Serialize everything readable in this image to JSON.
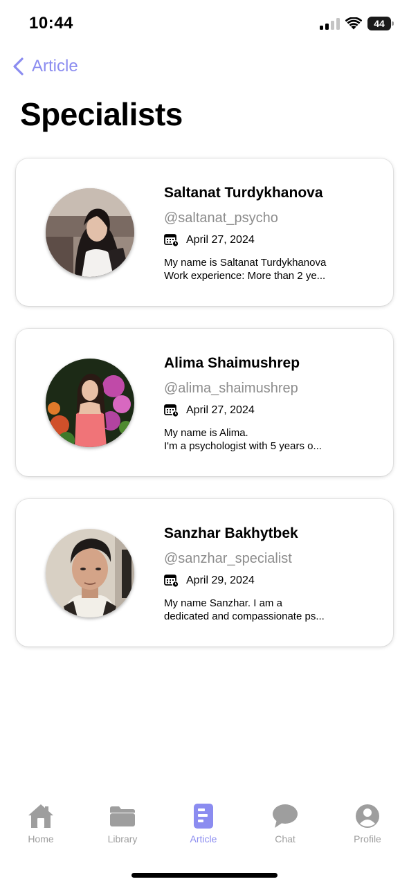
{
  "status_bar": {
    "time": "10:44",
    "battery": "44"
  },
  "nav": {
    "back_label": "Article"
  },
  "page": {
    "title": "Specialists"
  },
  "specialists": [
    {
      "name": "Saltanat Turdykhanova",
      "handle": "@saltanat_psycho",
      "date": "April 27, 2024",
      "bio_line1": "My name is Saltanat Turdykhanova",
      "bio_line2": "Work experience: More than 2 ye..."
    },
    {
      "name": "Alima Shaimushrep",
      "handle": "@alima_shaimushrep",
      "date": "April 27, 2024",
      "bio_line1": "My name is Alima.",
      "bio_line2": "I'm a psychologist with 5 years o..."
    },
    {
      "name": "Sanzhar Bakhytbek",
      "handle": "@sanzhar_specialist",
      "date": "April 29, 2024",
      "bio_line1": "My name Sanzhar. I am a",
      "bio_line2": "dedicated and compassionate ps..."
    }
  ],
  "tab_bar": {
    "items": [
      {
        "label": "Home",
        "icon": "home-icon"
      },
      {
        "label": "Library",
        "icon": "folder-icon"
      },
      {
        "label": "Article",
        "icon": "article-icon",
        "active": true
      },
      {
        "label": "Chat",
        "icon": "chat-icon"
      },
      {
        "label": "Profile",
        "icon": "profile-icon"
      }
    ]
  },
  "colors": {
    "accent": "#8b8cf0",
    "inactive": "#9e9e9e",
    "text": "#000000",
    "muted": "#8d8d8d"
  }
}
